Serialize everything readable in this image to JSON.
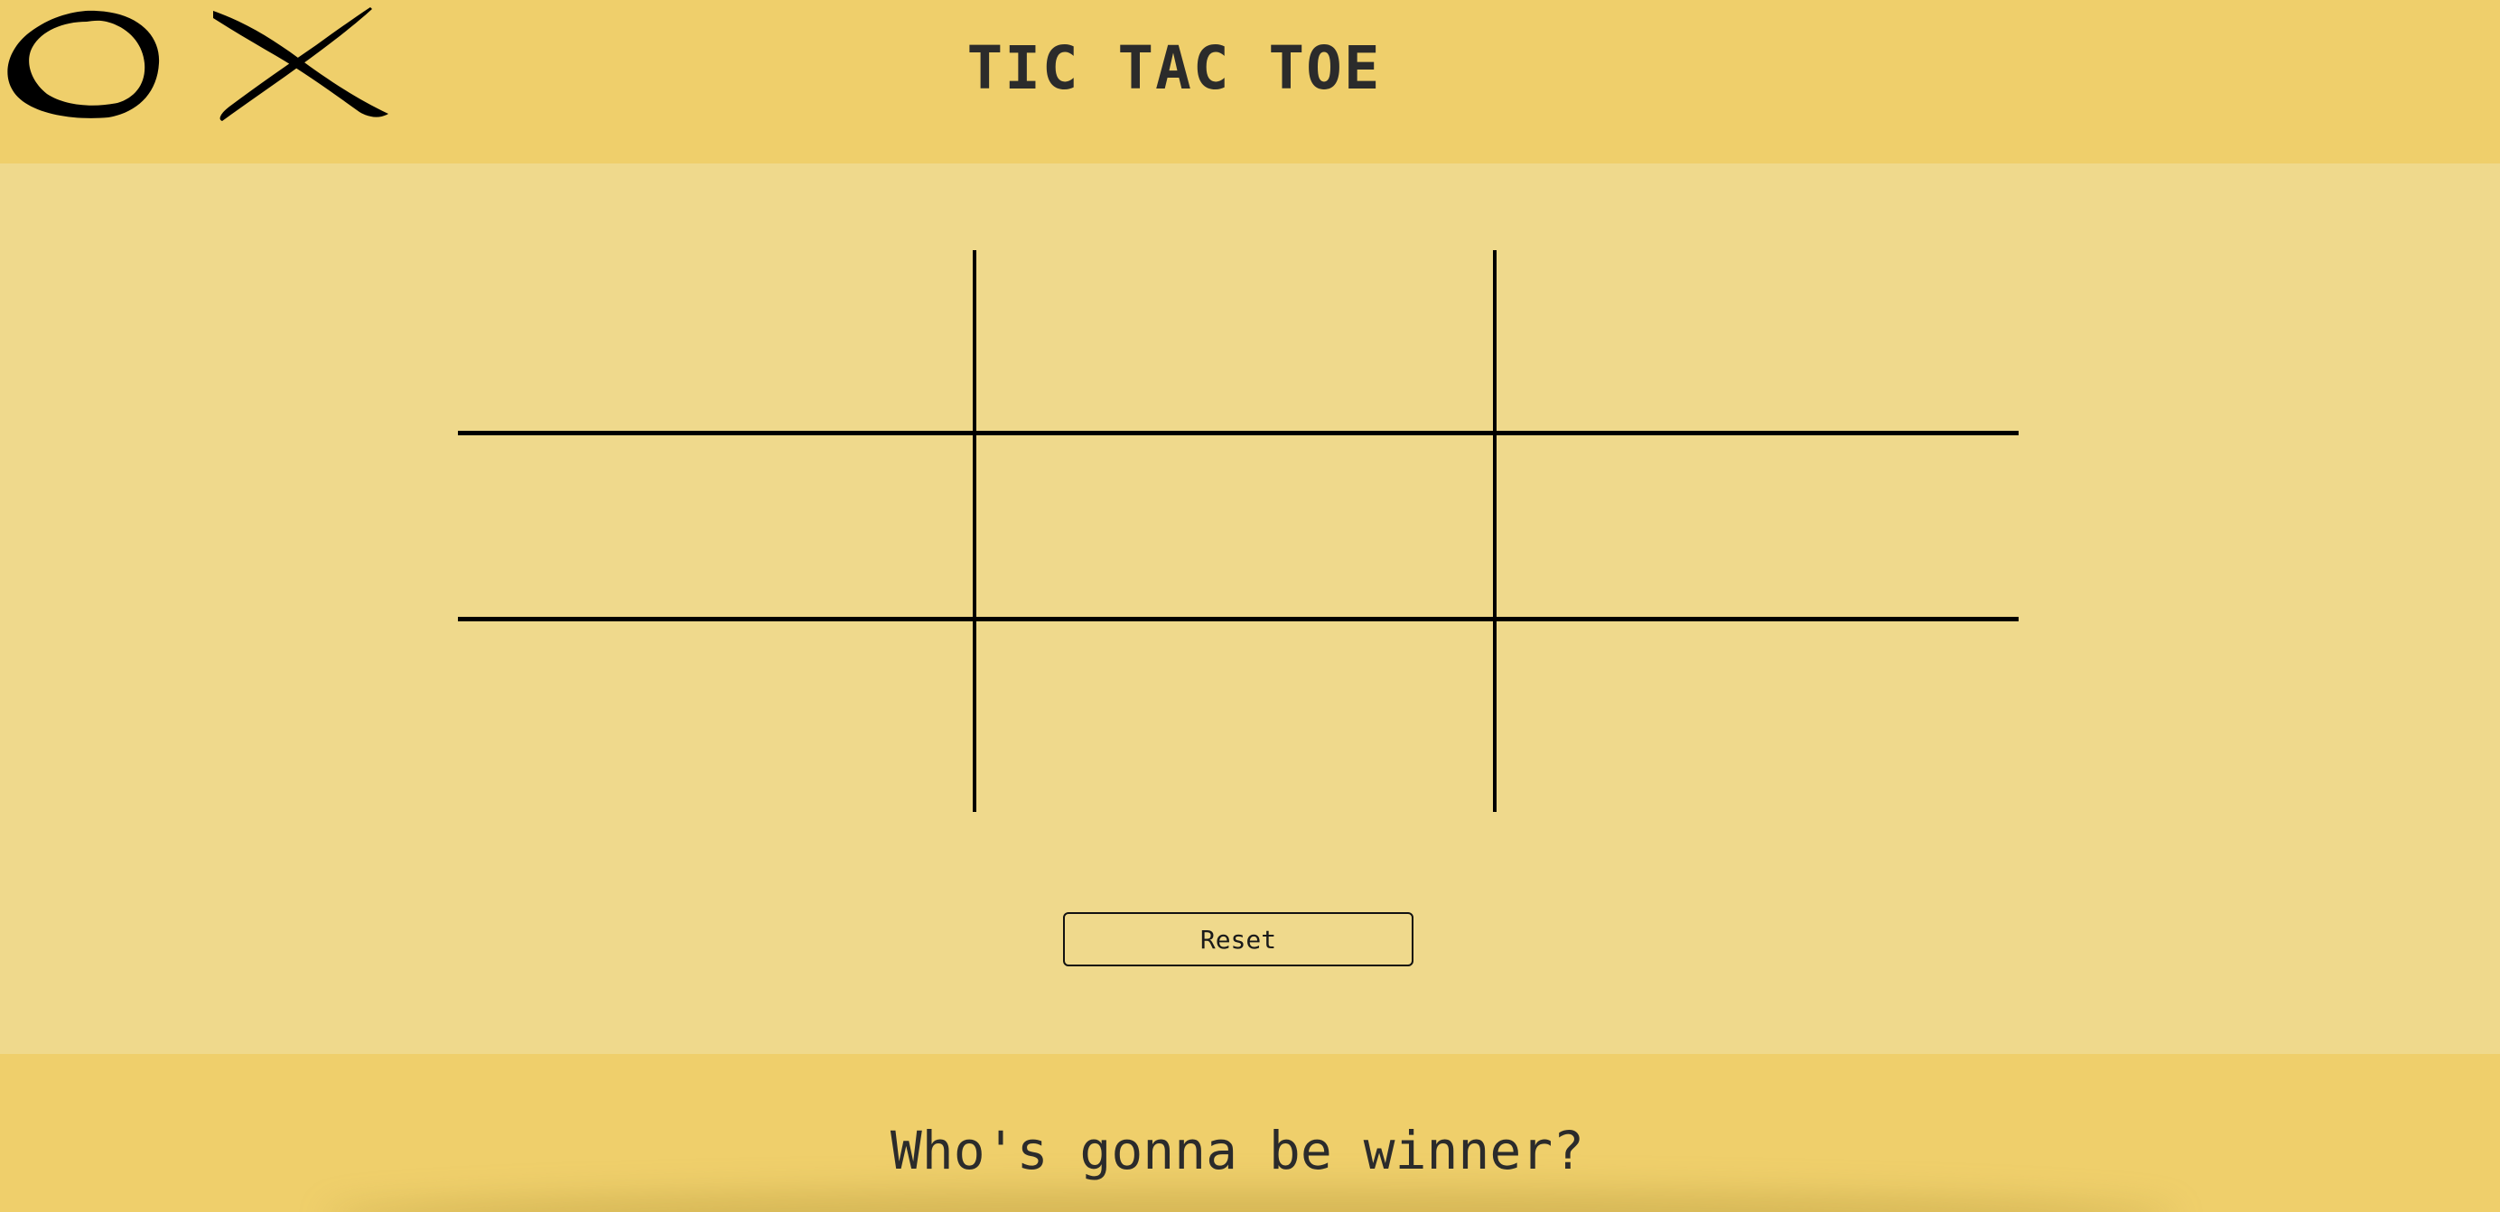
{
  "header": {
    "title": "TIC TAC TOE",
    "logo_icons": [
      "o-icon",
      "x-icon"
    ]
  },
  "board": {
    "rows": 3,
    "cols": 3,
    "cells": [
      "",
      "",
      "",
      "",
      "",
      "",
      "",
      "",
      ""
    ]
  },
  "controls": {
    "reset_label": "Reset"
  },
  "footer": {
    "status_text": "Who's gonna be winner?"
  },
  "colors": {
    "header_bg": "#efcf6b",
    "board_bg": "#efd98c",
    "grid_line": "#000000",
    "text": "#2b2b2b"
  }
}
